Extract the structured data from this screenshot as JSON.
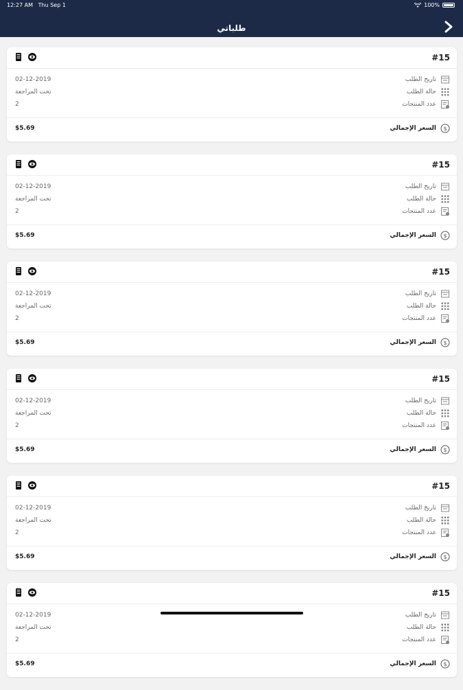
{
  "status_bar": {
    "time": "12:27 AM",
    "date": "Thu Sep 1",
    "battery": "100%"
  },
  "header": {
    "title": "طلباتي"
  },
  "labels": {
    "order_date": "تاريخ الطلب",
    "order_status": "حالة الطلب",
    "product_count": "عدد المنتجات",
    "total_price": "السعر الإجمالي"
  },
  "orders": [
    {
      "number": "#15",
      "date": "02-12-2019",
      "status": "تحت المراجعة",
      "count": "2",
      "total": "$5.69"
    },
    {
      "number": "#15",
      "date": "02-12-2019",
      "status": "تحت المراجعة",
      "count": "2",
      "total": "$5.69"
    },
    {
      "number": "#15",
      "date": "02-12-2019",
      "status": "تحت المراجعة",
      "count": "2",
      "total": "$5.69"
    },
    {
      "number": "#15",
      "date": "02-12-2019",
      "status": "تحت المراجعة",
      "count": "2",
      "total": "$5.69"
    },
    {
      "number": "#15",
      "date": "02-12-2019",
      "status": "تحت المراجعة",
      "count": "2",
      "total": "$5.69"
    },
    {
      "number": "#15",
      "date": "02-12-2019",
      "status": "تحت المراجعة",
      "count": "2",
      "total": "$5.69"
    }
  ],
  "colors": {
    "header_bg": "#1c2a48",
    "page_bg": "#f2f2f2"
  },
  "icons": {
    "back": "chevron-right-icon",
    "invoice": "invoice-icon",
    "view": "eye-icon",
    "date": "calendar-icon",
    "status": "grid-icon",
    "count": "receipt-icon",
    "total": "dollar-circle-icon"
  }
}
